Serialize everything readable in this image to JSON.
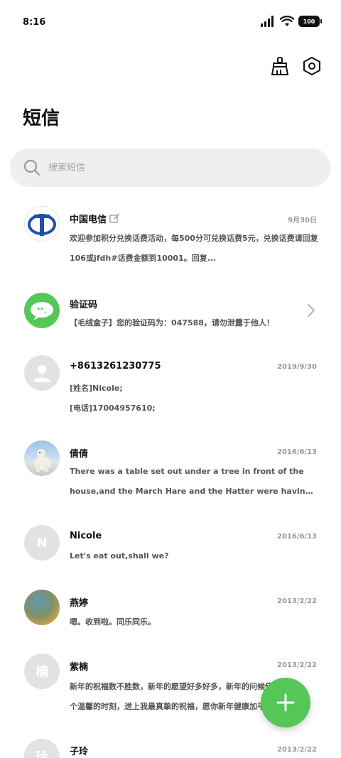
{
  "status_bar": {
    "time": "8:16",
    "battery": "100"
  },
  "header": {
    "title": "短信"
  },
  "search": {
    "placeholder": "搜索短信"
  },
  "conversations": [
    {
      "name": "中国电信",
      "date": "9月30日",
      "lines": [
        "欢迎参加积分兑换话费活动，每500分可兑换话费5元，兑换话费请回复",
        "106或jfdh#话费金额到10001。回复..."
      ]
    },
    {
      "name": "验证码",
      "date": "",
      "lines": [
        "【毛绒盒子】您的验证码为：047588，请勿泄露于他人！"
      ]
    },
    {
      "name": "+8613261230775",
      "date": "2019/9/30",
      "lines": [
        "[姓名]Nicole;",
        "[电话]17004957610;"
      ]
    },
    {
      "name": "倩倩",
      "date": "2016/6/13",
      "lines": [
        "There was a table set out under a tree in front of the",
        "house,and the March Hare and the Hatter were having tea ..."
      ]
    },
    {
      "name": "Nicole",
      "date": "2016/6/13",
      "avatar_letter": "N",
      "lines": [
        "Let's eat out,shall we?"
      ]
    },
    {
      "name": "燕婷",
      "date": "2013/2/22",
      "lines": [
        "嗯。收到啦。同乐同乐。"
      ]
    },
    {
      "name": "紫楠",
      "date": "2013/2/22",
      "avatar_letter": "楠",
      "lines": [
        "新年的祝福数不胜数，新年的愿望好多好多，新年的问候传递在这",
        "个温馨的时刻，送上我最真挚的祝福，愿你新年健康加平安..."
      ]
    },
    {
      "name": "子玲",
      "date": "2013/2/22",
      "avatar_letter": "玲",
      "lines": []
    }
  ],
  "colors": {
    "accent_green": "#55c757",
    "telecom_blue": "#1f4fa8",
    "avatar_grey": "#e2e2e2"
  },
  "icons": {
    "clean": "broom-icon",
    "settings": "hexagon-gear-icon",
    "new_message": "plus-icon"
  }
}
